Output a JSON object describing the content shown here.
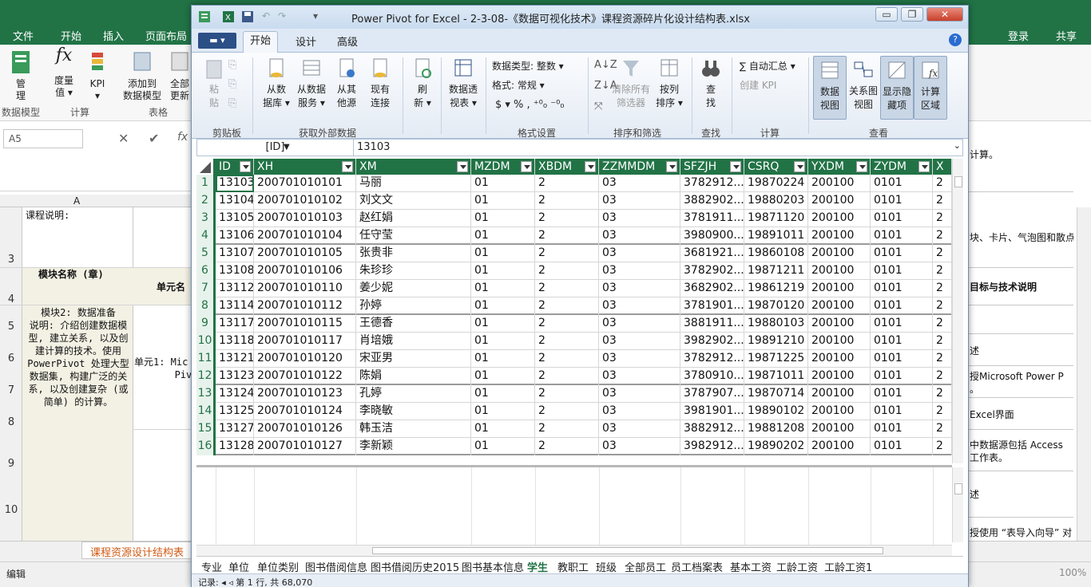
{
  "excel": {
    "menu": [
      "文件",
      "开始",
      "插入",
      "页面布局"
    ],
    "login": "登录",
    "share": "共享",
    "ribbon_buttons": [
      {
        "label": "管\n理",
        "icon": "manage-icon"
      },
      {
        "label": "度量\n值 ▾",
        "icon": "measure-icon"
      },
      {
        "label": "KPI\n▾",
        "icon": "kpi-icon"
      },
      {
        "label": "添加到\n数据模型",
        "icon": "add-model-icon"
      },
      {
        "label": "全部\n更新",
        "icon": "refresh-icon"
      }
    ],
    "ribbon_groups": [
      "数据模型",
      "计算",
      "表格"
    ],
    "name_box": "A5",
    "col_header": "A",
    "row_numbers": [
      "3",
      "4",
      "5",
      "6",
      "7",
      "8",
      "9",
      "10"
    ],
    "cells": {
      "a3": "课程说明:",
      "a4": "模块名称 (章)",
      "b4": "单元名",
      "a5": "模块2: 数据准备\n说明: 介绍创建数据模\n型, 建立关系, 以及创\n建计算的技术。使用\nPowerPivot 处理大型\n数据集, 构建广泛的关\n系, 以及创建复杂 (或\n简单) 的计算。",
      "b6": "单元1: Mic\n       Pivo"
    },
    "right_formula": "计算。",
    "right_cells": [
      "块、卡片、气泡图和散点",
      "目标与技术说明",
      "述",
      "授Microsoft Power P\n。",
      "Excel界面",
      "中数据源包括 Access\n工作表。",
      "述",
      "授使用 “表导入向导” 对"
    ],
    "sheet_tab": "课程资源设计结构表",
    "status": "编辑",
    "zoom": "100%"
  },
  "pp": {
    "title": "Power Pivot for Excel - 2-3-08-《数据可视化技术》课程资源碎片化设计结构表.xlsx",
    "window_buttons": [
      "▭",
      "❐",
      "✕"
    ],
    "tabs": [
      "开始",
      "设计",
      "高级"
    ],
    "ribbon": {
      "clipboard": {
        "paste": "粘\n贴",
        "group": "剪贴板"
      },
      "external": {
        "from_db": "从数\n据库 ▾",
        "from_service": "从数据\n服务 ▾",
        "from_other": "从其\n他源",
        "existing": "现有\n连接",
        "group": "获取外部数据"
      },
      "refresh": "刷\n新 ▾",
      "pivot": "数据透\n视表 ▾",
      "format": {
        "datatype_label": "数据类型: 整数 ▾",
        "format_label": "格式: 常规 ▾",
        "currency": "$ ▾  %  ,  ⁺⁰₀ ⁻⁰₀",
        "group": "格式设置"
      },
      "sort": {
        "clear": "清除所有\n筛选器",
        "by_col": "按列\n排序 ▾",
        "group": "排序和筛选"
      },
      "find": {
        "label": "查\n找",
        "group": "查找"
      },
      "calc": {
        "autosum": "∑ 自动汇总 ▾",
        "kpi": "创建 KPI",
        "group": "计算"
      },
      "view": {
        "data_view": "数据\n视图",
        "diagram": "关系图\n视图",
        "show_hidden": "显示隐\n藏项",
        "calc_area": "计算\n区域",
        "group": "查看"
      }
    },
    "formula_bar": {
      "column": "[ID]",
      "value": "13103"
    },
    "columns": [
      "ID",
      "XH",
      "XM",
      "MZDM",
      "XBDM",
      "ZZMMDM",
      "SFZJH",
      "CSRQ",
      "YXDM",
      "ZYDM",
      "X"
    ],
    "rows": [
      [
        "13103",
        "200701010101",
        "马丽",
        "01",
        "2",
        "03",
        "3782912...",
        "19870224",
        "200100",
        "0101",
        "2"
      ],
      [
        "13104",
        "200701010102",
        "刘文文",
        "01",
        "2",
        "03",
        "3882902...",
        "19880203",
        "200100",
        "0101",
        "2"
      ],
      [
        "13105",
        "200701010103",
        "赵红娟",
        "01",
        "2",
        "03",
        "3781911...",
        "19871120",
        "200100",
        "0101",
        "2"
      ],
      [
        "13106",
        "200701010104",
        "任守莹",
        "01",
        "2",
        "03",
        "3980900...",
        "19891011",
        "200100",
        "0101",
        "2"
      ],
      [
        "13107",
        "200701010105",
        "张贵非",
        "01",
        "2",
        "03",
        "3681921...",
        "19860108",
        "200100",
        "0101",
        "2"
      ],
      [
        "13108",
        "200701010106",
        "朱珍珍",
        "01",
        "2",
        "03",
        "3782902...",
        "19871211",
        "200100",
        "0101",
        "2"
      ],
      [
        "13112",
        "200701010110",
        "姜少妮",
        "01",
        "2",
        "03",
        "3682902...",
        "19861219",
        "200100",
        "0101",
        "2"
      ],
      [
        "13114",
        "200701010112",
        "孙婷",
        "01",
        "2",
        "03",
        "3781901...",
        "19870120",
        "200100",
        "0101",
        "2"
      ],
      [
        "13117",
        "200701010115",
        "王德香",
        "01",
        "2",
        "03",
        "3881911...",
        "19880103",
        "200100",
        "0101",
        "2"
      ],
      [
        "13118",
        "200701010117",
        "肖培娥",
        "01",
        "2",
        "03",
        "3982902...",
        "19891210",
        "200100",
        "0101",
        "2"
      ],
      [
        "13121",
        "200701010120",
        "宋亚男",
        "01",
        "2",
        "03",
        "3782912...",
        "19871225",
        "200100",
        "0101",
        "2"
      ],
      [
        "13123",
        "200701010122",
        "陈娟",
        "01",
        "2",
        "03",
        "3780910...",
        "19871011",
        "200100",
        "0101",
        "2"
      ],
      [
        "13124",
        "200701010123",
        "孔婷",
        "01",
        "2",
        "03",
        "3787907...",
        "19870714",
        "200100",
        "0101",
        "2"
      ],
      [
        "13125",
        "200701010124",
        "李晓敏",
        "01",
        "2",
        "03",
        "3981901...",
        "19890102",
        "200100",
        "0101",
        "2"
      ],
      [
        "13127",
        "200701010126",
        "韩玉洁",
        "01",
        "2",
        "03",
        "3882912...",
        "19881208",
        "200100",
        "0101",
        "2"
      ],
      [
        "13128",
        "200701010127",
        "李新颖",
        "01",
        "2",
        "03",
        "3982912...",
        "19890202",
        "200100",
        "0101",
        "2"
      ]
    ],
    "sheet_tabs": [
      "专业",
      "单位",
      "单位类别",
      "图书借阅信息",
      "图书借阅历史2015",
      "图书基本信息",
      "学生",
      "教职工",
      "班级",
      "全部员工",
      "员工档案表",
      "基本工资",
      "工龄工资",
      "工龄工资1"
    ],
    "selected_sheet": "学生",
    "status": "记录: ◂  ◃  第 1 行, 共 68,070"
  }
}
